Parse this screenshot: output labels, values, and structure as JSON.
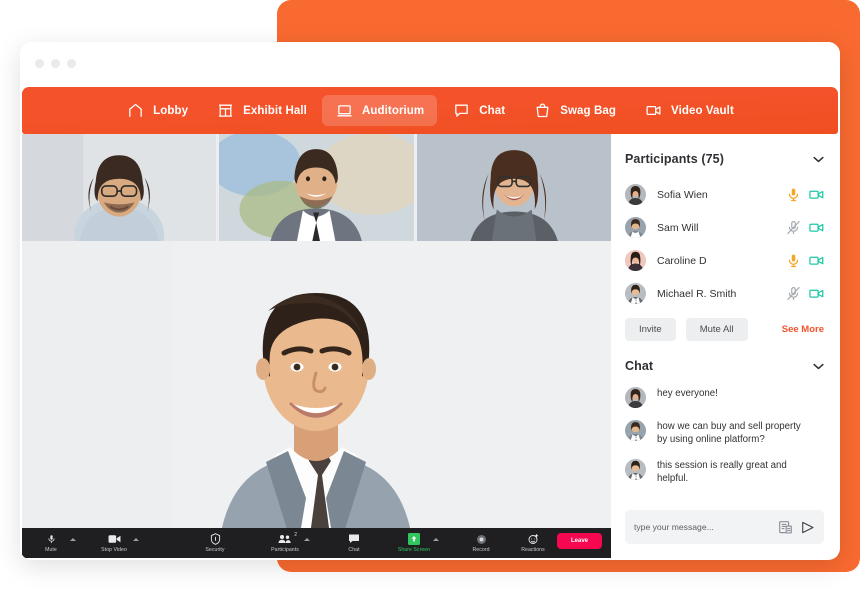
{
  "theme": {
    "orange": "#f4522a",
    "backdrop_orange": "#f96a30",
    "mic_on": "#f5a623",
    "mic_off": "#a8acb2",
    "camera": "#1fc8a6",
    "leave_red": "#f6074f",
    "share_green": "#31c55e"
  },
  "window": {
    "dots": [
      "close-dot",
      "minimize-dot",
      "maximize-dot"
    ]
  },
  "nav": {
    "items": [
      {
        "label": "Lobby",
        "icon": "home-icon",
        "active": false
      },
      {
        "label": "Exhibit Hall",
        "icon": "store-icon",
        "active": false
      },
      {
        "label": "Auditorium",
        "icon": "laptop-icon",
        "active": true
      },
      {
        "label": "Chat",
        "icon": "chat-bubble-icon",
        "active": false
      },
      {
        "label": "Swag Bag",
        "icon": "shopping-bag-icon",
        "active": false
      },
      {
        "label": "Video Vault",
        "icon": "video-camera-icon",
        "active": false
      }
    ]
  },
  "stage": {
    "thumbnails": [
      {
        "name": "participant-thumb-1"
      },
      {
        "name": "participant-thumb-2"
      },
      {
        "name": "participant-thumb-3"
      }
    ],
    "speaker": {
      "name": "active-speaker-video"
    }
  },
  "zoombar": {
    "controls": [
      {
        "label": "Mute",
        "icon": "microphone-icon",
        "caret": true,
        "badge": null,
        "green": false
      },
      {
        "label": "Stop Video",
        "icon": "video-camera-icon",
        "caret": true,
        "badge": null,
        "green": false
      },
      {
        "label": "Security",
        "icon": "shield-icon",
        "caret": false,
        "badge": null,
        "green": false
      },
      {
        "label": "Participants",
        "icon": "participants-icon",
        "caret": true,
        "badge": "2",
        "green": false
      },
      {
        "label": "Chat",
        "icon": "chat-bubble-icon",
        "caret": false,
        "badge": null,
        "green": false
      },
      {
        "label": "Share Screen",
        "icon": "share-screen-icon",
        "caret": true,
        "badge": null,
        "green": true
      },
      {
        "label": "Record",
        "icon": "record-icon",
        "caret": false,
        "badge": null,
        "green": false
      },
      {
        "label": "Reactions",
        "icon": "reactions-icon",
        "caret": false,
        "badge": null,
        "green": false
      }
    ],
    "leave_label": "Leave"
  },
  "sidebar": {
    "participants": {
      "title": "Participants (75)",
      "count": 75,
      "collapse_icon": "chevron-down-icon",
      "rows": [
        {
          "name": "Sofia Wien",
          "mic": "on",
          "camera": "on",
          "avatar": "woman-avatar-1"
        },
        {
          "name": "Sam Will",
          "mic": "off",
          "camera": "on",
          "avatar": "man-avatar-1"
        },
        {
          "name": "Caroline D",
          "mic": "on",
          "camera": "on",
          "avatar": "woman-avatar-2"
        },
        {
          "name": "Michael R. Smith",
          "mic": "off",
          "camera": "on",
          "avatar": "man-avatar-2"
        }
      ],
      "invite_label": "Invite",
      "mute_all_label": "Mute All",
      "see_more_label": "See More"
    },
    "chat": {
      "title": "Chat",
      "collapse_icon": "chevron-down-icon",
      "messages": [
        {
          "text": "hey everyone!",
          "avatar": "woman-avatar-1"
        },
        {
          "text": "how we can buy and  sell property by using online platform?",
          "avatar": "man-avatar-1"
        },
        {
          "text": "this session is really great and helpful.",
          "avatar": "man-avatar-2"
        }
      ],
      "input_placeholder": "type your message...",
      "input_value": "",
      "attach_icon": "document-image-icon",
      "send_icon": "send-paper-plane-icon"
    }
  }
}
